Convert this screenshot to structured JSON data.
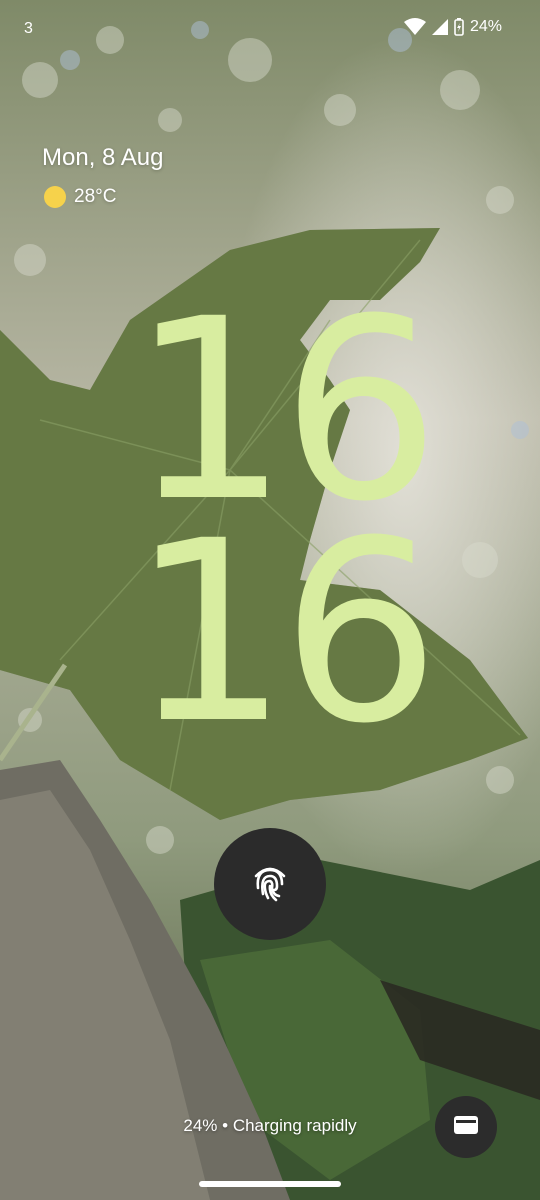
{
  "status_bar": {
    "notification_count": "3",
    "battery_percent": "24%",
    "icons": [
      "wifi-icon",
      "cellular-signal-icon",
      "battery-charging-icon"
    ]
  },
  "lockscreen": {
    "date": "Mon, 8 Aug",
    "weather": {
      "icon": "sun-icon",
      "temperature": "28°C"
    },
    "clock": {
      "hours": "16",
      "minutes": "16"
    },
    "charging_status": "24% • Charging rapidly",
    "fingerprint_icon": "fingerprint-icon",
    "wallet_icon": "wallet-icon"
  },
  "colors": {
    "clock": "#d8eda0",
    "sun": "#f6d24b",
    "button_bg": "#2b2b2b"
  }
}
